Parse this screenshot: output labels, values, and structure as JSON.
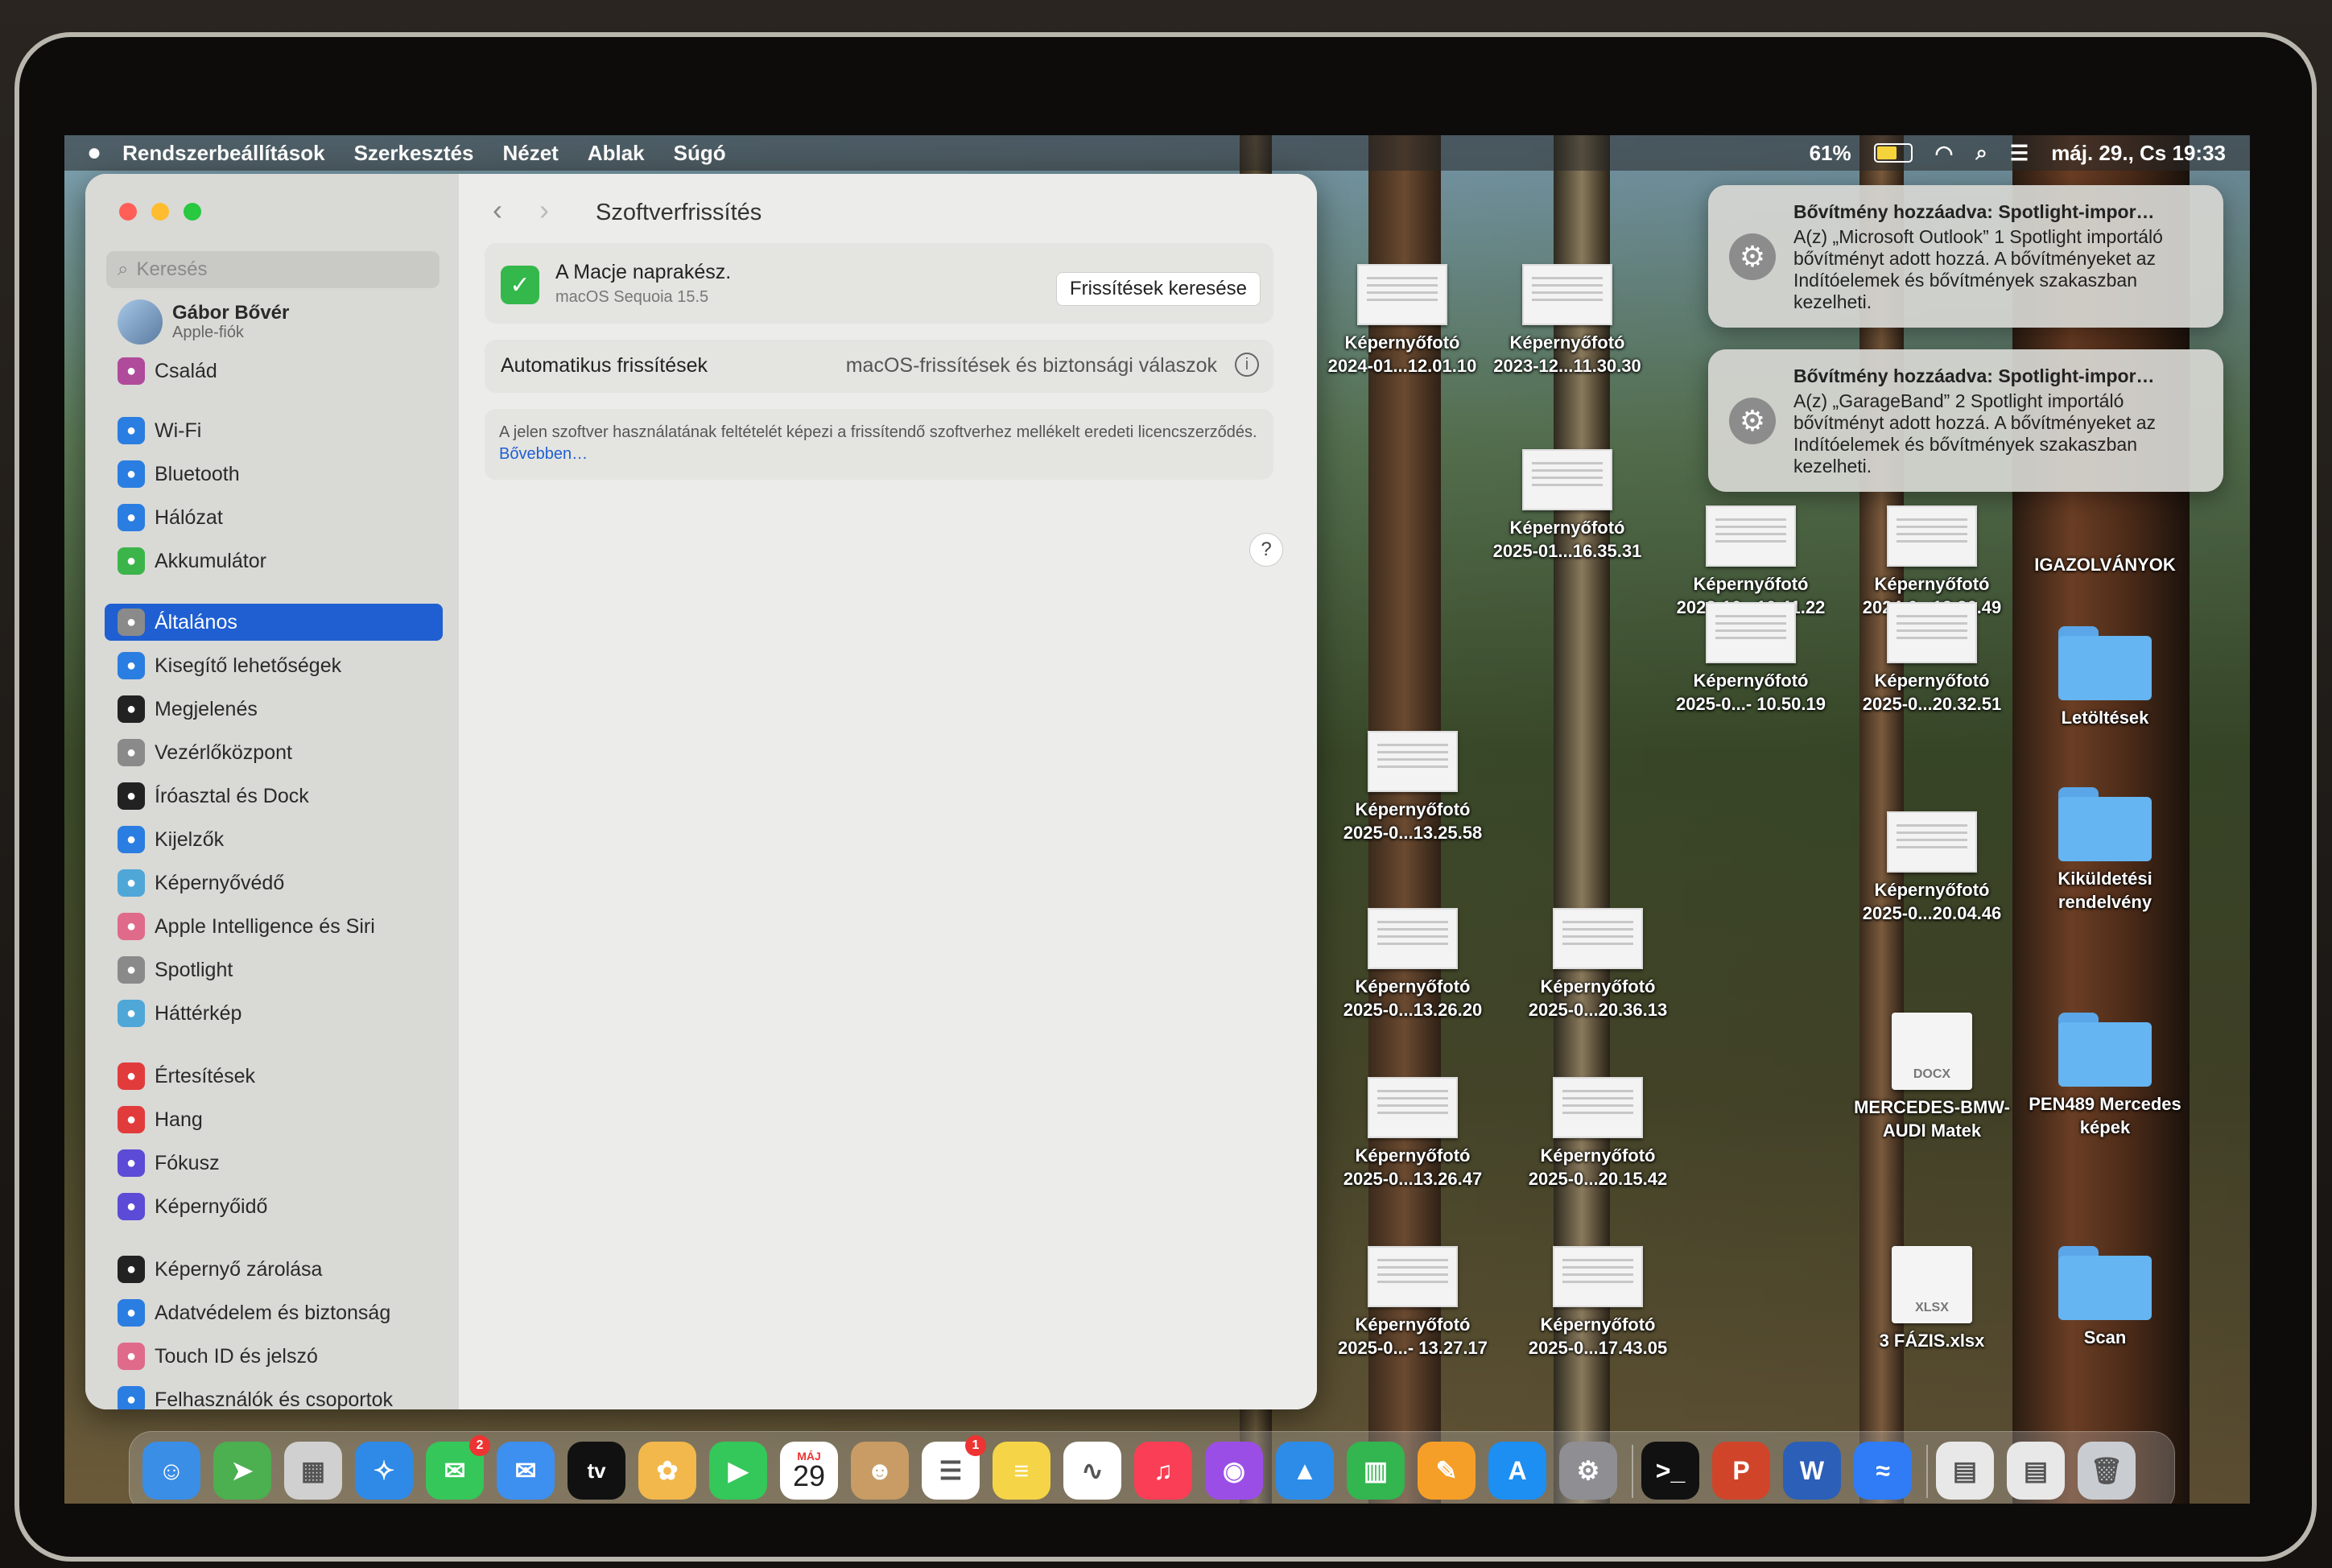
{
  "menubar": {
    "app_menu": [
      "Rendszerbeállítások",
      "Szerkesztés",
      "Nézet",
      "Ablak",
      "Súgó"
    ],
    "battery": "61%",
    "datetime": "máj. 29., Cs 19:33"
  },
  "settings": {
    "search_placeholder": "Keresés",
    "account_name": "Gábor Bővér",
    "account_sub": "Apple-fiók",
    "sidebar": [
      {
        "label": "Család",
        "color": "#b04a9b"
      },
      {
        "label": "Wi-Fi",
        "color": "#2a7de1"
      },
      {
        "label": "Bluetooth",
        "color": "#2a7de1"
      },
      {
        "label": "Hálózat",
        "color": "#2a7de1"
      },
      {
        "label": "Akkumulátor",
        "color": "#3bb54a"
      },
      {
        "label": "Általános",
        "color": "#8a8a8a"
      },
      {
        "label": "Kisegítő lehetőségek",
        "color": "#2a7de1"
      },
      {
        "label": "Megjelenés",
        "color": "#222222"
      },
      {
        "label": "Vezérlőközpont",
        "color": "#8a8a8a"
      },
      {
        "label": "Íróasztal és Dock",
        "color": "#222222"
      },
      {
        "label": "Kijelzők",
        "color": "#2a7de1"
      },
      {
        "label": "Képernyővédő",
        "color": "#4fa7d8"
      },
      {
        "label": "Apple Intelligence és Siri",
        "color": "#e06a8a"
      },
      {
        "label": "Spotlight",
        "color": "#8a8a8a"
      },
      {
        "label": "Háttérkép",
        "color": "#4fa7d8"
      },
      {
        "label": "Értesítések",
        "color": "#e23b3b"
      },
      {
        "label": "Hang",
        "color": "#e23b3b"
      },
      {
        "label": "Fókusz",
        "color": "#5b4bd6"
      },
      {
        "label": "Képernyőidő",
        "color": "#5b4bd6"
      },
      {
        "label": "Képernyő zárolása",
        "color": "#222222"
      },
      {
        "label": "Adatvédelem és biztonság",
        "color": "#2a7de1"
      },
      {
        "label": "Touch ID és jelszó",
        "color": "#e06a8a"
      },
      {
        "label": "Felhasználók és csoportok",
        "color": "#2a7de1"
      }
    ],
    "selected": "Általános",
    "main": {
      "title": "Szoftverfrissítés",
      "status_title": "A Macje naprakész.",
      "status_sub": "macOS Sequoia 15.5",
      "check_button": "Frissítések keresése",
      "auto_label": "Automatikus frissítések",
      "auto_value": "macOS-frissítések és biztonsági válaszok",
      "license_text": "A jelen szoftver használatának feltételét képezi a frissítendő szoftverhez mellékelt eredeti licencszerződés.",
      "license_link": "Bővebben…",
      "help": "?"
    }
  },
  "notifications": [
    {
      "title": "Bővítmény hozzáadva: Spotlight-impor…",
      "body": "A(z) „Microsoft Outlook” 1 Spotlight importáló bővítményt adott hozzá. A bővítményeket az Indítóelemek és bővítmények szakaszban kezelheti."
    },
    {
      "title": "Bővítmény hozzáadva: Spotlight-impor…",
      "body": "A(z) „GarageBand” 2 Spotlight importáló bővítményt adott hozzá. A bővítményeket az Indítóelemek és bővítmények szakaszban kezelheti."
    }
  ],
  "desktop": [
    {
      "type": "thumb",
      "l1": "Képernyőfotó",
      "l2": "2024-01...12.01.10"
    },
    {
      "type": "thumb",
      "l1": "Képernyőfotó",
      "l2": "2023-12...11.30.30"
    },
    {
      "type": "thumb",
      "l1": "Képernyőfotó",
      "l2": "2025-01...16.35.31"
    },
    {
      "type": "thumb",
      "l1": "Képernyőfotó",
      "l2": "2023-10...10.41.22"
    },
    {
      "type": "thumb",
      "l1": "Képernyőfotó",
      "l2": "2024-0...12.36.49"
    },
    {
      "type": "label",
      "l1": "IGAZOLVÁNYOK",
      "l2": ""
    },
    {
      "type": "thumb",
      "l1": "Képernyőfotó",
      "l2": "2025-0...- 10.50.19"
    },
    {
      "type": "thumb",
      "l1": "Képernyőfotó",
      "l2": "2025-0...20.32.51"
    },
    {
      "type": "folder",
      "l1": "Letöltések",
      "l2": ""
    },
    {
      "type": "thumb",
      "l1": "Képernyőfotó",
      "l2": "2025-0...13.25.58"
    },
    {
      "type": "thumb",
      "l1": "Képernyőfotó",
      "l2": "2025-0...20.04.46"
    },
    {
      "type": "folder",
      "l1": "Kiküldetési",
      "l2": "rendelvény"
    },
    {
      "type": "thumb",
      "l1": "Képernyőfotó",
      "l2": "2025-0...13.26.20"
    },
    {
      "type": "thumb",
      "l1": "Képernyőfotó",
      "l2": "2025-0...20.36.13"
    },
    {
      "type": "doc",
      "ext": "DOCX",
      "l1": "MERCEDES-BMW-",
      "l2": "AUDI Matek"
    },
    {
      "type": "folder",
      "l1": "PEN489 Mercedes",
      "l2": "képek"
    },
    {
      "type": "thumb",
      "l1": "Képernyőfotó",
      "l2": "2025-0...13.26.47"
    },
    {
      "type": "thumb",
      "l1": "Képernyőfotó",
      "l2": "2025-0...20.15.42"
    },
    {
      "type": "thumb",
      "l1": "Képernyőfotó",
      "l2": "2025-0...- 13.27.17"
    },
    {
      "type": "thumb",
      "l1": "Képernyőfotó",
      "l2": "2025-0...17.43.05"
    },
    {
      "type": "doc",
      "ext": "XLSX",
      "l1": "3 FÁZIS.xlsx",
      "l2": ""
    },
    {
      "type": "folder",
      "l1": "Scan",
      "l2": ""
    }
  ],
  "dock": {
    "calendar_month": "MÁJ",
    "calendar_day": "29",
    "messages_badge": "2",
    "reminders_badge": "1",
    "apps": [
      {
        "name": "finder-icon",
        "color": "#3a8ee6",
        "glyph": "☺"
      },
      {
        "name": "maps-icon",
        "color": "#4caf50",
        "glyph": "➤"
      },
      {
        "name": "launchpad-icon",
        "color": "#d0d0d0",
        "glyph": "▦"
      },
      {
        "name": "safari-icon",
        "color": "#2e8ae6",
        "glyph": "✧"
      },
      {
        "name": "messages-icon",
        "color": "#35c759",
        "glyph": "✉"
      },
      {
        "name": "mail-icon",
        "color": "#3d8ff0",
        "glyph": "✉"
      },
      {
        "name": "tv-icon",
        "color": "#111111",
        "glyph": "tv"
      },
      {
        "name": "photos-icon",
        "color": "#f2b84b",
        "glyph": "✿"
      },
      {
        "name": "facetime-icon",
        "color": "#34c759",
        "glyph": "▶"
      },
      {
        "name": "calendar-icon",
        "color": "#ffffff",
        "glyph": ""
      },
      {
        "name": "contacts-icon",
        "color": "#c89c64",
        "glyph": "☻"
      },
      {
        "name": "reminders-icon",
        "color": "#ffffff",
        "glyph": "☰"
      },
      {
        "name": "notes-icon",
        "color": "#f6d447",
        "glyph": "≡"
      },
      {
        "name": "freeform-icon",
        "color": "#ffffff",
        "glyph": "∿"
      },
      {
        "name": "music-icon",
        "color": "#fa3e55",
        "glyph": "♫"
      },
      {
        "name": "podcasts-icon",
        "color": "#9b4ee6",
        "glyph": "◉"
      },
      {
        "name": "keynote-icon",
        "color": "#2d8ce8",
        "glyph": "▲"
      },
      {
        "name": "numbers-icon",
        "color": "#33b550",
        "glyph": "▥"
      },
      {
        "name": "pages-icon",
        "color": "#f59f29",
        "glyph": "✎"
      },
      {
        "name": "app-store-icon",
        "color": "#1d8ef2",
        "glyph": "A"
      },
      {
        "name": "system-settings-icon",
        "color": "#8e8e93",
        "glyph": "⚙"
      },
      {
        "name": "terminal-icon",
        "color": "#111111",
        "glyph": ">_"
      },
      {
        "name": "powerpoint-icon",
        "color": "#d0452a",
        "glyph": "P"
      },
      {
        "name": "word-icon",
        "color": "#2b5fb8",
        "glyph": "W"
      },
      {
        "name": "messenger-icon",
        "color": "#2f7cf6",
        "glyph": "≈"
      },
      {
        "name": "pdf-document-icon",
        "color": "#e8e8e8",
        "glyph": "▤"
      },
      {
        "name": "stack-icon",
        "color": "#e8e8e8",
        "glyph": "▤"
      },
      {
        "name": "trash-icon",
        "color": "#c9cdd2",
        "glyph": "🗑"
      }
    ]
  }
}
